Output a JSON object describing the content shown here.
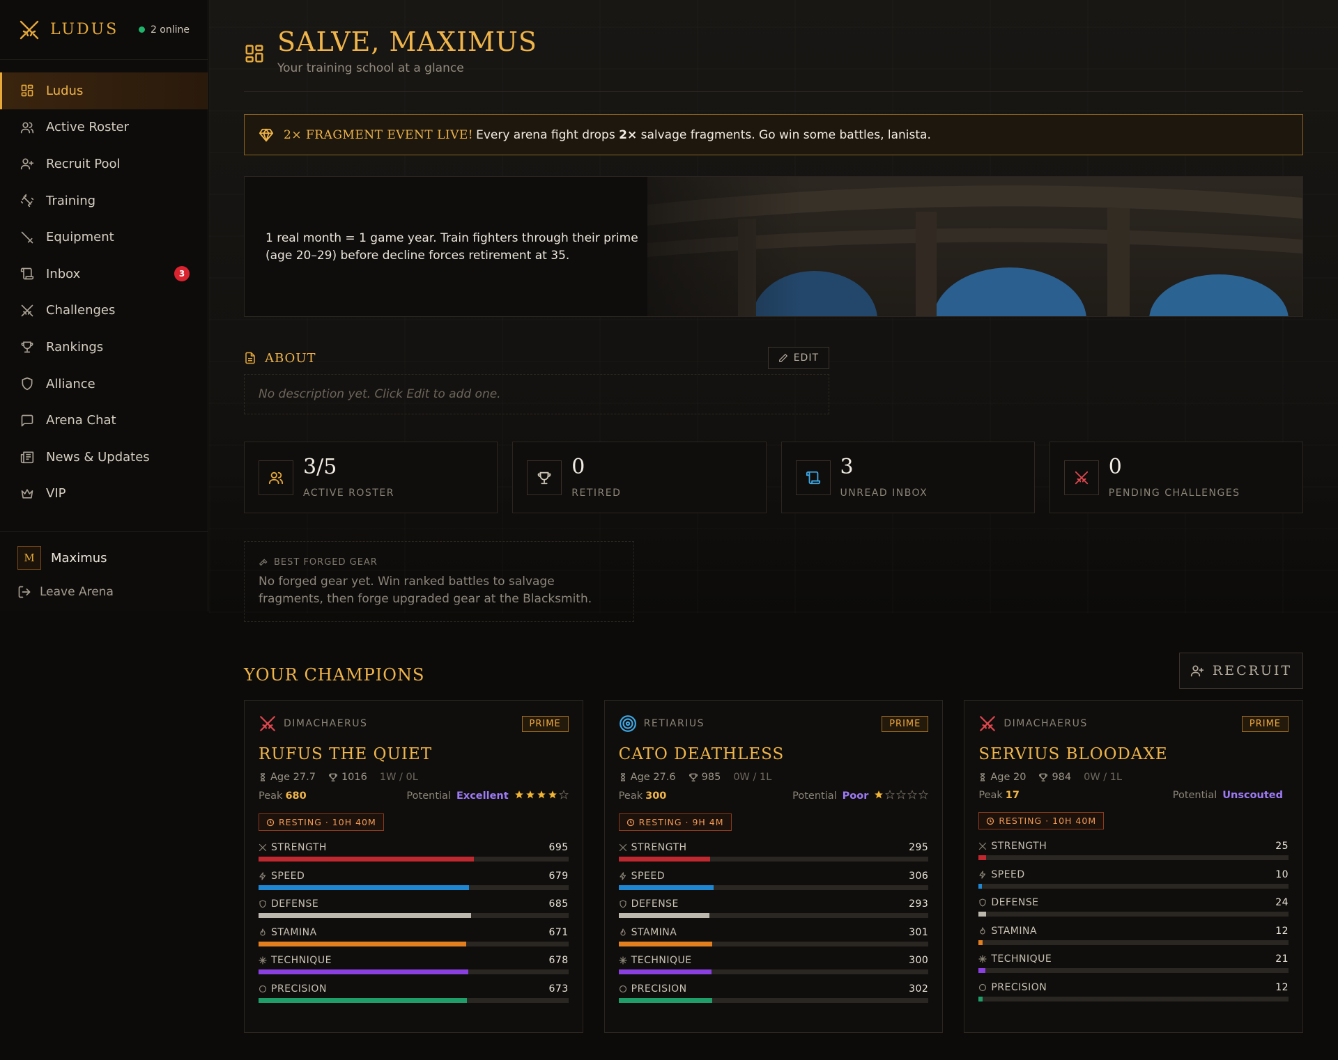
{
  "sidebar": {
    "brand": "LUDUS",
    "online": "2 online",
    "items": [
      {
        "label": "Ludus",
        "icon": "dashboard-icon",
        "active": true
      },
      {
        "label": "Active Roster",
        "icon": "users-icon"
      },
      {
        "label": "Recruit Pool",
        "icon": "user-plus-icon"
      },
      {
        "label": "Training",
        "icon": "dumbbell-icon"
      },
      {
        "label": "Equipment",
        "icon": "sword-icon"
      },
      {
        "label": "Inbox",
        "icon": "scroll-icon",
        "badge": "3"
      },
      {
        "label": "Challenges",
        "icon": "crossed-swords-icon"
      },
      {
        "label": "Rankings",
        "icon": "trophy-icon"
      },
      {
        "label": "Alliance",
        "icon": "shield-icon"
      },
      {
        "label": "Arena Chat",
        "icon": "chat-icon"
      },
      {
        "label": "News & Updates",
        "icon": "newspaper-icon"
      },
      {
        "label": "VIP",
        "icon": "crown-icon"
      }
    ],
    "user": {
      "initial": "M",
      "name": "Maximus"
    },
    "leave": "Leave Arena"
  },
  "header": {
    "title": "SALVE, MAXIMUS",
    "subtitle": "Your training school at a glance"
  },
  "event": {
    "tag": "2× FRAGMENT EVENT LIVE!",
    "text_a": "Every arena fight drops ",
    "text_b": "2×",
    "text_c": " salvage fragments. Go win some battles, lanista."
  },
  "hero": {
    "text": "1 real month = 1 game year. Train fighters through their prime (age 20–29) before decline forces retirement at 35."
  },
  "about": {
    "title": "ABOUT",
    "edit": "EDIT",
    "placeholder": "No description yet. Click Edit to add one."
  },
  "stats": [
    {
      "value": "3/5",
      "label": "ACTIVE ROSTER",
      "icon": "users-icon",
      "color": "#e6a93a"
    },
    {
      "value": "0",
      "label": "RETIRED",
      "icon": "trophy-icon",
      "color": "#cfc7b8"
    },
    {
      "value": "3",
      "label": "UNREAD INBOX",
      "icon": "scroll-icon",
      "color": "#3ea8e6"
    },
    {
      "value": "0",
      "label": "PENDING CHALLENGES",
      "icon": "crossed-swords-icon",
      "color": "#e0474f"
    }
  ],
  "forged": {
    "title": "BEST FORGED GEAR",
    "text": "No forged gear yet. Win ranked battles to salvage fragments, then forge upgraded gear at the Blacksmith."
  },
  "champions": {
    "title": "YOUR CHAMPIONS",
    "recruit": "RECRUIT",
    "cards": [
      {
        "class": "DIMACHAERUS",
        "class_icon": "crossed-swords-icon",
        "badge": "PRIME",
        "name": "RUFUS THE QUIET",
        "age": "Age 27.7",
        "rating": "1016",
        "record": "1W / 0L",
        "peak_label": "Peak",
        "peak": "680",
        "potential_label": "Potential",
        "potential": "Excellent",
        "stars": 4,
        "status": "RESTING · 10H 40M",
        "stats": [
          {
            "name": "STRENGTH",
            "value": "695",
            "pct": 0.695
          },
          {
            "name": "SPEED",
            "value": "679",
            "pct": 0.679
          },
          {
            "name": "DEFENSE",
            "value": "685",
            "pct": 0.685
          },
          {
            "name": "STAMINA",
            "value": "671",
            "pct": 0.671
          },
          {
            "name": "TECHNIQUE",
            "value": "678",
            "pct": 0.678
          },
          {
            "name": "PRECISION",
            "value": "673",
            "pct": 0.673
          }
        ]
      },
      {
        "class": "RETIARIUS",
        "class_icon": "net-target-icon",
        "badge": "PRIME",
        "name": "CATO DEATHLESS",
        "age": "Age 27.6",
        "rating": "985",
        "record": "0W / 1L",
        "peak_label": "Peak",
        "peak": "300",
        "potential_label": "Potential",
        "potential": "Poor",
        "stars": 1,
        "status": "RESTING · 9H 4M",
        "stats": [
          {
            "name": "STRENGTH",
            "value": "295",
            "pct": 0.295
          },
          {
            "name": "SPEED",
            "value": "306",
            "pct": 0.306
          },
          {
            "name": "DEFENSE",
            "value": "293",
            "pct": 0.293
          },
          {
            "name": "STAMINA",
            "value": "301",
            "pct": 0.301
          },
          {
            "name": "TECHNIQUE",
            "value": "300",
            "pct": 0.3
          },
          {
            "name": "PRECISION",
            "value": "302",
            "pct": 0.302
          }
        ]
      },
      {
        "class": "DIMACHAERUS",
        "class_icon": "crossed-swords-icon",
        "badge": "PRIME",
        "name": "SERVIUS BLOODAXE",
        "age": "Age 20",
        "rating": "984",
        "record": "0W / 1L",
        "peak_label": "Peak",
        "peak": "17",
        "potential_label": "Potential",
        "potential": "Unscouted",
        "stars": 0,
        "status": "RESTING · 10H 40M",
        "stats": [
          {
            "name": "STRENGTH",
            "value": "25",
            "pct": 0.025
          },
          {
            "name": "SPEED",
            "value": "10",
            "pct": 0.01
          },
          {
            "name": "DEFENSE",
            "value": "24",
            "pct": 0.024
          },
          {
            "name": "STAMINA",
            "value": "12",
            "pct": 0.012
          },
          {
            "name": "TECHNIQUE",
            "value": "21",
            "pct": 0.021
          },
          {
            "name": "PRECISION",
            "value": "12",
            "pct": 0.012
          }
        ]
      }
    ]
  },
  "colors": {
    "accent": "#f0b54a",
    "strength": "#c0282f",
    "speed": "#1f86d1",
    "defense": "#bdb8ae",
    "stamina": "#e37f1e",
    "technique": "#8a3fe0",
    "precision": "#1f9e6a"
  }
}
